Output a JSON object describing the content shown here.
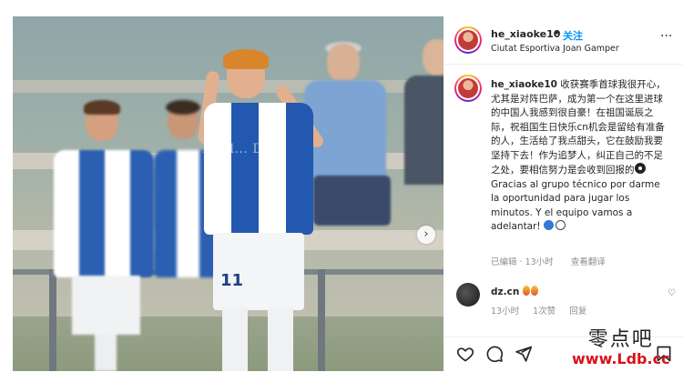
{
  "post": {
    "username": "he_xiaoke10",
    "separator": "•",
    "follow_label": "关注",
    "location": "Ciutat Esportiva Joan Gamper",
    "more_label": "···"
  },
  "photo": {
    "watermark": "Noel... Dom",
    "jersey_number": "11",
    "next_label": "›"
  },
  "caption": {
    "username": "he_xiaoke10",
    "text_cn": "收获赛季首球我很开心，尤其是对阵巴萨，成为第一个在这里进球的中国人我感到很自豪！在祖国诞辰之际，祝祖国生日快乐cn机会是留给有准备的人，生活给了我点甜头，它在鼓励我要坚持下去！作为追梦人，纠正自己的不足之处，要相信努力是会收到回报的",
    "text_es": "Gracias al grupo técnico por darme la oportunidad para jugar los minutos. Y el equipo vamos a adelantar!",
    "edited": "已编辑",
    "time": "13小时",
    "translate": "查看翻译"
  },
  "comment": {
    "username": "dz.cn",
    "time": "13小时",
    "likes": "1次赞",
    "reply": "回复"
  },
  "actions": {
    "like_icon": "heart-icon",
    "comment_icon": "comment-icon",
    "share_icon": "share-icon",
    "save_icon": "bookmark-icon"
  },
  "watermark": {
    "cn": "零点吧",
    "url": "www.Ldb.cc"
  },
  "colors": {
    "follow": "#0095f6",
    "kit_blue": "#2358b0",
    "watermark_red": "#d9121a"
  }
}
